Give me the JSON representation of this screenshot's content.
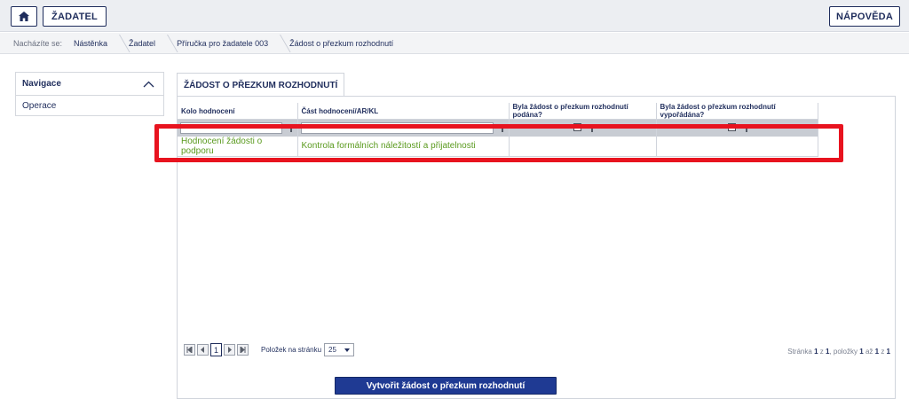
{
  "topbar": {
    "home_icon": "home-icon",
    "zadatel_label": "ŽADATEL",
    "napoveda_label": "NÁPOVĚDA"
  },
  "breadcrumb": {
    "label": "Nacházíte se:",
    "items": [
      "Nástěnka",
      "Žadatel",
      "Příručka pro žadatele 003",
      "Žádost o přezkum rozhodnutí"
    ]
  },
  "nav": {
    "title": "Navigace",
    "collapse_icon": "chevron-up-icon",
    "items": [
      "Operace"
    ]
  },
  "main": {
    "tab_label": "ŽÁDOST O PŘEZKUM ROZHODNUTÍ",
    "table": {
      "columns": [
        "Kolo hodnocení",
        "Část hodnocení/AR/KL",
        "Byla žádost o přezkum rozhodnutí podána?",
        "Byla žádost o přezkum rozhodnutí vypořádána?"
      ],
      "rows": [
        [
          "Hodnocení žádosti o podporu",
          "Kontrola formálních náležitostí a přijatelnosti",
          "",
          ""
        ]
      ]
    },
    "pager": {
      "current_page": "1",
      "per_page_label": "Položek na stránku",
      "per_page_value": "25",
      "info_prefix": "Stránka",
      "info_page": "1",
      "info_of": "z",
      "info_total_pages": "1",
      "info_items_label": ", položky",
      "info_from": "1",
      "info_to_label": "až",
      "info_to": "1",
      "info_of2": "z",
      "info_total_items": "1"
    },
    "create_button_label": "Vytvořit žádost o přezkum rozhodnutí"
  },
  "colors": {
    "primary": "#1f3a93",
    "link_green": "#5a9a1e",
    "highlight_red": "#e8131f"
  }
}
